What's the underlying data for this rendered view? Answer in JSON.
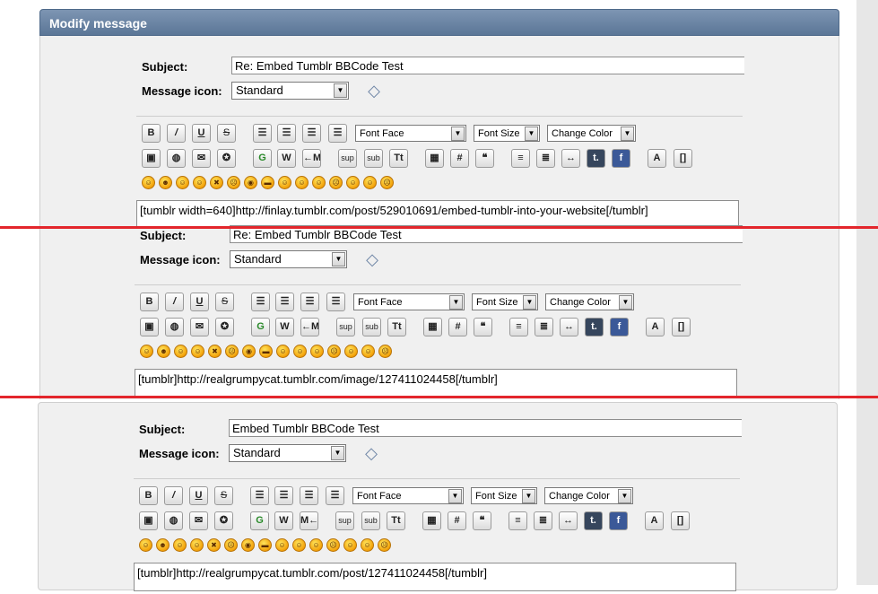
{
  "panel_title": "Modify message",
  "labels": {
    "subject": "Subject:",
    "message_icon": "Message icon:"
  },
  "colors": {
    "header": "#6a84a4",
    "divider_line": "#e3262c"
  },
  "toolbar": {
    "row1": [
      {
        "icon": "bold-icon",
        "glyph": "B"
      },
      {
        "icon": "italic-icon",
        "glyph": "/"
      },
      {
        "icon": "underline-icon",
        "glyph": "U"
      },
      {
        "icon": "strikethrough-icon",
        "glyph": "S"
      },
      {
        "icon": "align-left-icon",
        "glyph": "☰"
      },
      {
        "icon": "justify-icon",
        "glyph": "☰"
      },
      {
        "icon": "align-center-icon",
        "glyph": "☰"
      },
      {
        "icon": "align-right-icon",
        "glyph": "☰"
      }
    ],
    "font_face": "Font Face",
    "font_size": "Font Size",
    "change_color": "Change Color",
    "row2": [
      {
        "icon": "image-icon",
        "glyph": "▣"
      },
      {
        "icon": "globe-link-icon",
        "glyph": "◍"
      },
      {
        "icon": "email-icon",
        "glyph": "✉"
      },
      {
        "icon": "flash-icon",
        "glyph": "✪"
      },
      {
        "icon": "google-icon",
        "glyph": "G"
      },
      {
        "icon": "wikipedia-icon",
        "glyph": "W"
      },
      {
        "icon": "m-link-icon",
        "glyph": "←M"
      },
      {
        "icon": "superscript-icon",
        "glyph": "sup"
      },
      {
        "icon": "subscript-icon",
        "glyph": "sub"
      },
      {
        "icon": "teletype-icon",
        "glyph": "Tt"
      },
      {
        "icon": "table-icon",
        "glyph": "▦"
      },
      {
        "icon": "hash-code-icon",
        "glyph": "#"
      },
      {
        "icon": "quote-icon",
        "glyph": "❝"
      },
      {
        "icon": "bullet-list-icon",
        "glyph": "≡"
      },
      {
        "icon": "numbered-list-icon",
        "glyph": "≣"
      },
      {
        "icon": "horizontal-rule-icon",
        "glyph": "↔"
      },
      {
        "icon": "tumblr-icon",
        "glyph": "t."
      },
      {
        "icon": "facebook-icon",
        "glyph": "f"
      },
      {
        "icon": "font-style-icon",
        "glyph": "A"
      },
      {
        "icon": "remove-format-icon",
        "glyph": "[]"
      }
    ],
    "row2_alt_m": "M←",
    "emoticons": [
      "☺",
      "☻",
      "☺",
      "☺",
      "✖",
      "☹",
      "◉",
      "▬",
      "☺",
      "☺",
      "☺",
      "☹",
      "☺",
      "☺",
      "☹"
    ]
  },
  "sections": [
    {
      "subject": "Re: Embed Tumblr BBCode Test",
      "message_icon": "Standard",
      "body": "[tumblr width=640]http://finlay.tumblr.com/post/529010691/embed-tumblr-into-your-website[/tumblr]"
    },
    {
      "subject": "Re: Embed Tumblr BBCode Test",
      "message_icon": "Standard",
      "body": "[tumblr]http://realgrumpycat.tumblr.com/image/127411024458[/tumblr]"
    },
    {
      "subject": "Embed Tumblr BBCode Test",
      "message_icon": "Standard",
      "body": "[tumblr]http://realgrumpycat.tumblr.com/post/127411024458[/tumblr]"
    }
  ]
}
